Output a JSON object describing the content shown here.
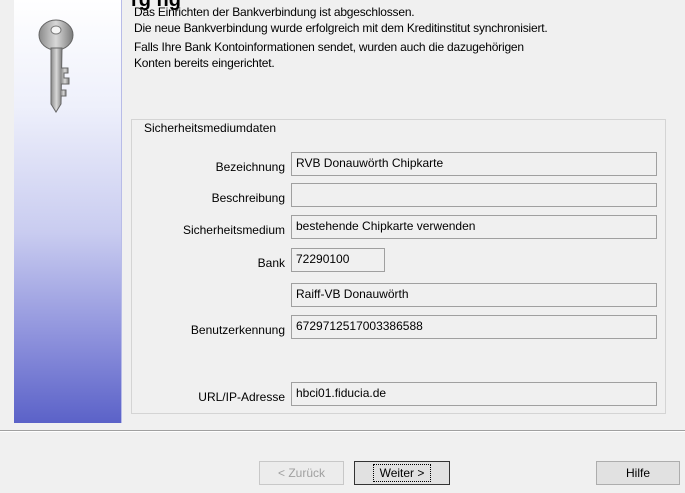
{
  "header": {
    "partial_title": "rg     ng"
  },
  "intro": {
    "line1": "Das Einrichten der Bankverbindung ist abgeschlossen.",
    "line2": "Die neue Bankverbindung wurde erfolgreich mit dem Kreditinstitut synchronisiert.",
    "line3": "Falls Ihre Bank Kontoinformationen sendet, wurden auch die dazugehörigen",
    "line4": "Konten bereits eingerichtet."
  },
  "group": {
    "title": "Sicherheitsmediumdaten",
    "labels": {
      "bezeichnung": "Bezeichnung",
      "beschreibung": "Beschreibung",
      "sicherheitsmedium": "Sicherheitsmedium",
      "bank": "Bank",
      "benutzerkennung": "Benutzerkennung",
      "url": "URL/IP-Adresse"
    },
    "values": {
      "bezeichnung": "RVB Donauwörth Chipkarte",
      "beschreibung": "",
      "sicherheitsmedium": "bestehende Chipkarte verwenden",
      "bank_code": "72290100",
      "bank_name": "Raiff-VB Donauwörth",
      "benutzerkennung": "6729712517003386588",
      "url": "hbci01.fiducia.de"
    }
  },
  "buttons": {
    "back": "< Zurück",
    "next": "Weiter >",
    "help": "Hilfe"
  },
  "icons": {
    "wizard_icon": "key-icon"
  }
}
